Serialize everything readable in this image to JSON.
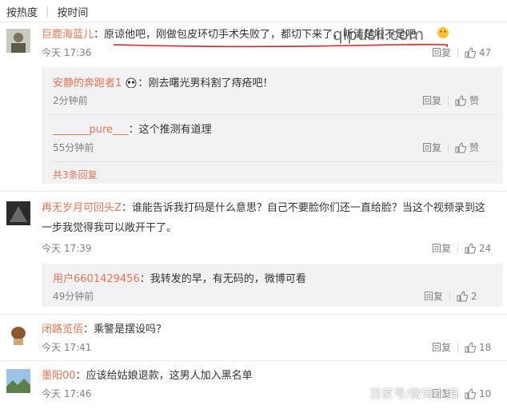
{
  "sort": {
    "hot": "按热度",
    "time": "按时间"
  },
  "comments": [
    {
      "user": "巨鹿海蓝儿",
      "text": "原谅他吧，刚做包皮环切手术失败了，都切下来了，听清楚啦不是吧",
      "time": "今天 17:36",
      "reply": "回复",
      "likes": "47",
      "replies": [
        {
          "user": "安静的奔跑者1",
          "text": "刚去曙光男科割了痔疮吧！",
          "time": "2分钟前",
          "reply": "回复",
          "like": "赞"
        },
        {
          "user": "_______pure___",
          "text": "这个推测有道理",
          "time": "55分钟前",
          "reply": "回复",
          "like": "赞"
        }
      ],
      "more": "共3条回复"
    },
    {
      "user": "再无岁月可回头Z",
      "text_line1": "谁能告诉我打码是什么意思？自己不要脸你们还一直给脸？当这个视频录到这",
      "text_line2": "一步我觉得我可以敞开干了。",
      "time": "今天 17:39",
      "reply": "回复",
      "likes": "24",
      "replies": [
        {
          "user": "用户6601429456",
          "text": "我转发的早，有无码的，微博可看",
          "time": "49分钟前",
          "reply": "回复",
          "likes": "2"
        }
      ]
    },
    {
      "user": "闭路览佰",
      "text": "乘警是摆设吗？",
      "time": "今天 17:41",
      "reply": "回复",
      "likes": "18"
    },
    {
      "user": "墨阳00",
      "text": "应该给姑娘退款，这男人加入黑名单",
      "time": "今天 17:46",
      "reply": "回复",
      "likes": "10"
    }
  ],
  "watermarks": {
    "top": "qipusii.com",
    "bottom": "百家号/微博小编"
  },
  "colors": {
    "username": "#eb7350",
    "muted": "#808080",
    "reply_bg": "#f2f2f5"
  }
}
